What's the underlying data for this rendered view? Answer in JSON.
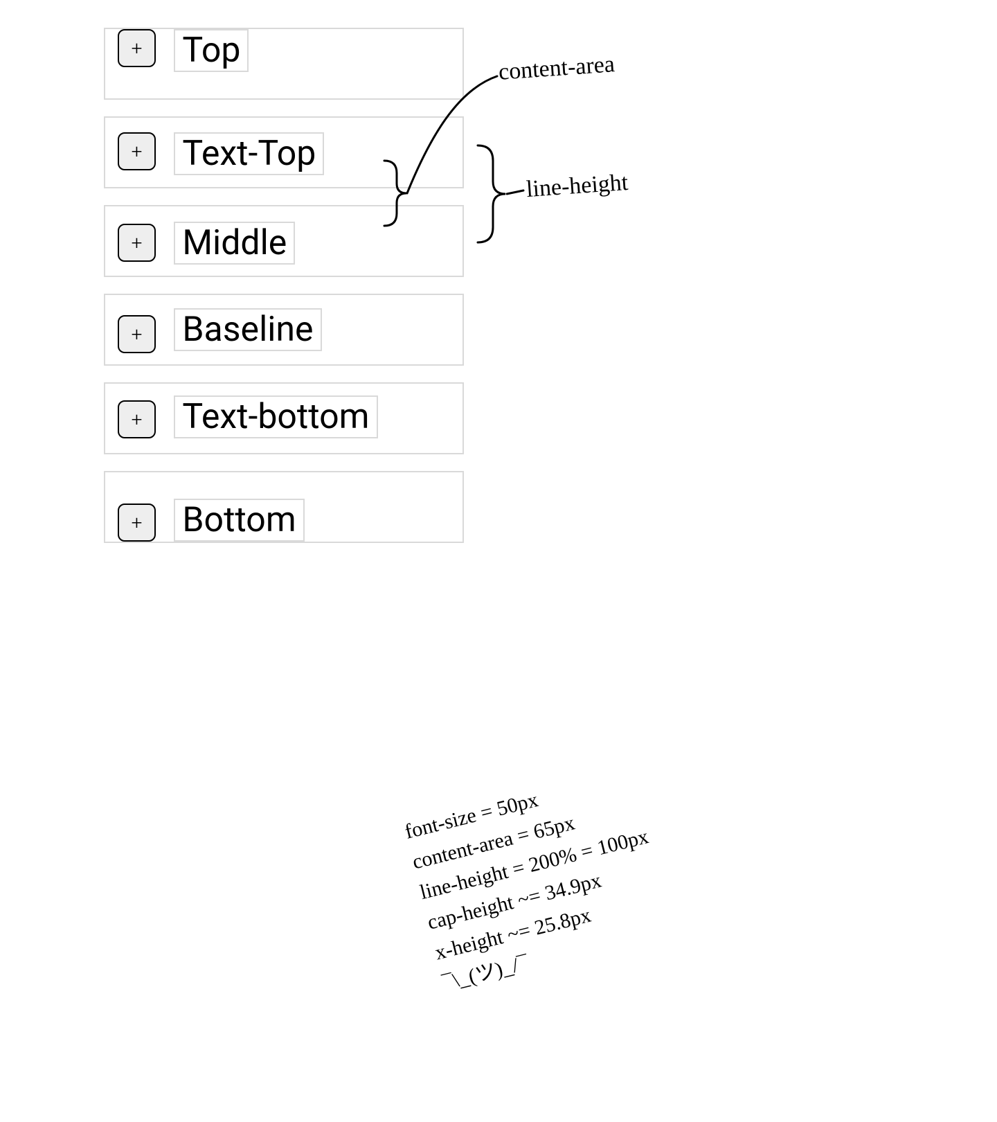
{
  "rows": [
    {
      "label": "Top",
      "align": "top",
      "glyph": "+"
    },
    {
      "label": "Text-Top",
      "align": "text-top",
      "glyph": "+"
    },
    {
      "label": "Middle",
      "align": "middle",
      "glyph": "+"
    },
    {
      "label": "Baseline",
      "align": "baseline",
      "glyph": "+"
    },
    {
      "label": "Text-bottom",
      "align": "text-bottom",
      "glyph": "+"
    },
    {
      "label": "Bottom",
      "align": "bottom",
      "glyph": "+"
    }
  ],
  "annotations": {
    "content_area": "content-area",
    "line_height": "line-height"
  },
  "metrics": {
    "lines": [
      "font-size = 50px",
      "content-area = 65px",
      "line-height = 200% = 100px",
      "cap-height ~= 34.9px",
      "x-height ~= 25.8px",
      "¯\\_(ツ)_/¯"
    ]
  }
}
